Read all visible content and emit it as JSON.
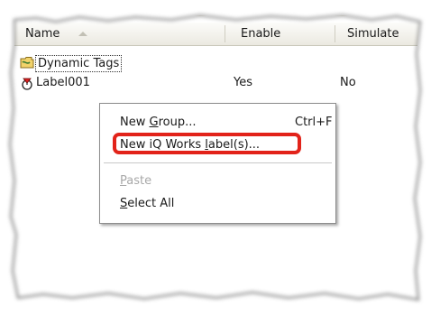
{
  "columns": [
    "Name",
    "Enable",
    "Simulate"
  ],
  "rows": [
    {
      "name": "Dynamic Tags",
      "enable": "",
      "simulate": "",
      "icon": "folder-icon"
    },
    {
      "name": "Label001",
      "enable": "Yes",
      "simulate": "No",
      "icon": "tag-icon"
    }
  ],
  "context_menu": {
    "items": [
      {
        "label_prefix": "New ",
        "label_mnemonic": "G",
        "label_suffix": "roup...",
        "shortcut": "Ctrl+F",
        "enabled": true
      },
      {
        "label_prefix": "New iQ Works ",
        "label_mnemonic": "l",
        "label_suffix": "abel(s)...",
        "shortcut": "",
        "enabled": true,
        "highlighted": true
      },
      {
        "label_prefix": "",
        "label_mnemonic": "P",
        "label_suffix": "aste",
        "shortcut": "",
        "enabled": false
      },
      {
        "label_prefix": "",
        "label_mnemonic": "S",
        "label_suffix": "elect All",
        "shortcut": "",
        "enabled": true
      }
    ]
  },
  "colors": {
    "highlight": "#e2231a",
    "disabled_text": "#a8a8a8"
  }
}
